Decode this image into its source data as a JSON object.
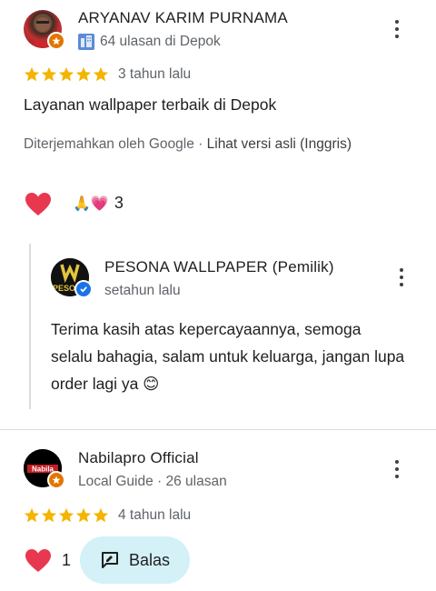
{
  "review1": {
    "author": "ARYANAV KARIM PURNAMA",
    "meta": "64 ulasan di Depok",
    "time": "3 tahun lalu",
    "text": "Layanan wallpaper terbaik di Depok",
    "translated_by": "Diterjemahkan oleh Google",
    "separator": " · ",
    "view_original": "Lihat versi asli (Inggris)",
    "reaction_count": "3",
    "reaction_emojis": "🙏💗"
  },
  "owner_reply": {
    "author": "PESONA WALLPAPER (Pemilik)",
    "time": "setahun lalu",
    "text": "Terima kasih atas kepercayaannya, semoga selalu bahagia, salam untuk keluarga, jangan lupa order lagi ya 😊",
    "logo_text": "PESONA"
  },
  "review2": {
    "author": "Nabilapro Official",
    "meta": "Local Guide · 26 ulasan",
    "time": "4 tahun lalu",
    "like_count": "1",
    "reply_label": "Balas",
    "avatar_text": "Nabila"
  },
  "colors": {
    "star": "#f4b400",
    "heart": "#e8384f",
    "badge": "#e37400",
    "reply_bg": "#d3f1f7"
  }
}
